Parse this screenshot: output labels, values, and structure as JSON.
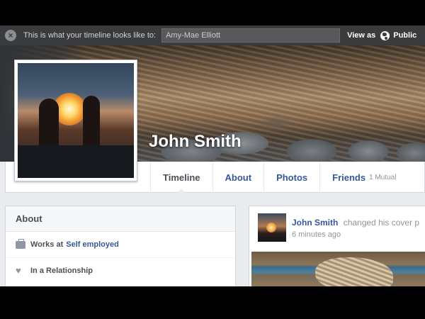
{
  "viewbar": {
    "label": "This is what your timeline looks like to:",
    "viewer_value": "Amy-Mae Elliott",
    "view_as_label": "View as",
    "public_label": "Public"
  },
  "profile": {
    "name": "John Smith"
  },
  "nav": {
    "tabs": [
      {
        "label": "Timeline",
        "active": true
      },
      {
        "label": "About"
      },
      {
        "label": "Photos"
      },
      {
        "label": "Friends",
        "sub": "1 Mutual"
      }
    ]
  },
  "about": {
    "title": "About",
    "works_prefix": "Works at",
    "works_link": "Self employed",
    "relationship": "In a Relationship"
  },
  "post": {
    "author": "John Smith",
    "action": "changed his cover p",
    "time": "6 minutes ago"
  },
  "colors": {
    "link": "#365899",
    "viewbar_bg": "#3a3b3c",
    "page_bg": "#e9ebee"
  }
}
